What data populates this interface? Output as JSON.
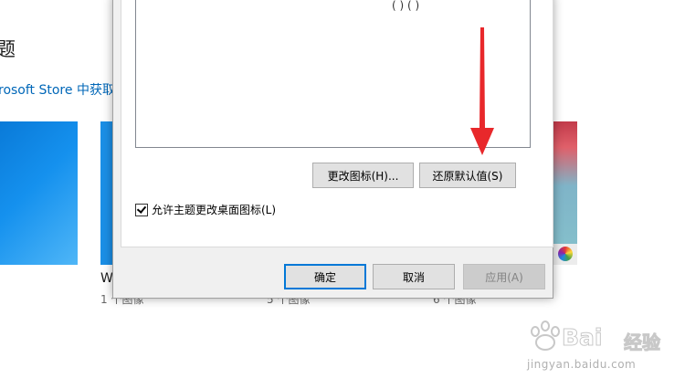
{
  "background": {
    "title_fragment": "题",
    "store_link": "rosoft Store 中获取",
    "theme_name_fragment": "W",
    "theme_counts": [
      "1 个图像",
      "5 个图像",
      "6 个图像"
    ]
  },
  "dialog": {
    "list_stub": "( ) ( )",
    "change_icon_button": "更改图标(H)...",
    "restore_default_button": "还原默认值(S)",
    "allow_theme_checkbox": {
      "label": "允许主题更改桌面图标(L)",
      "checked": true
    },
    "ok_button": "确定",
    "cancel_button": "取消",
    "apply_button": "应用(A)"
  },
  "overlay": {
    "arrow_color": "#e8282b"
  },
  "watermark": {
    "brand": "Bai 经验",
    "brand_latin": "Bai",
    "brand_cn": "经验",
    "url": "jingyan.baidu.com"
  }
}
